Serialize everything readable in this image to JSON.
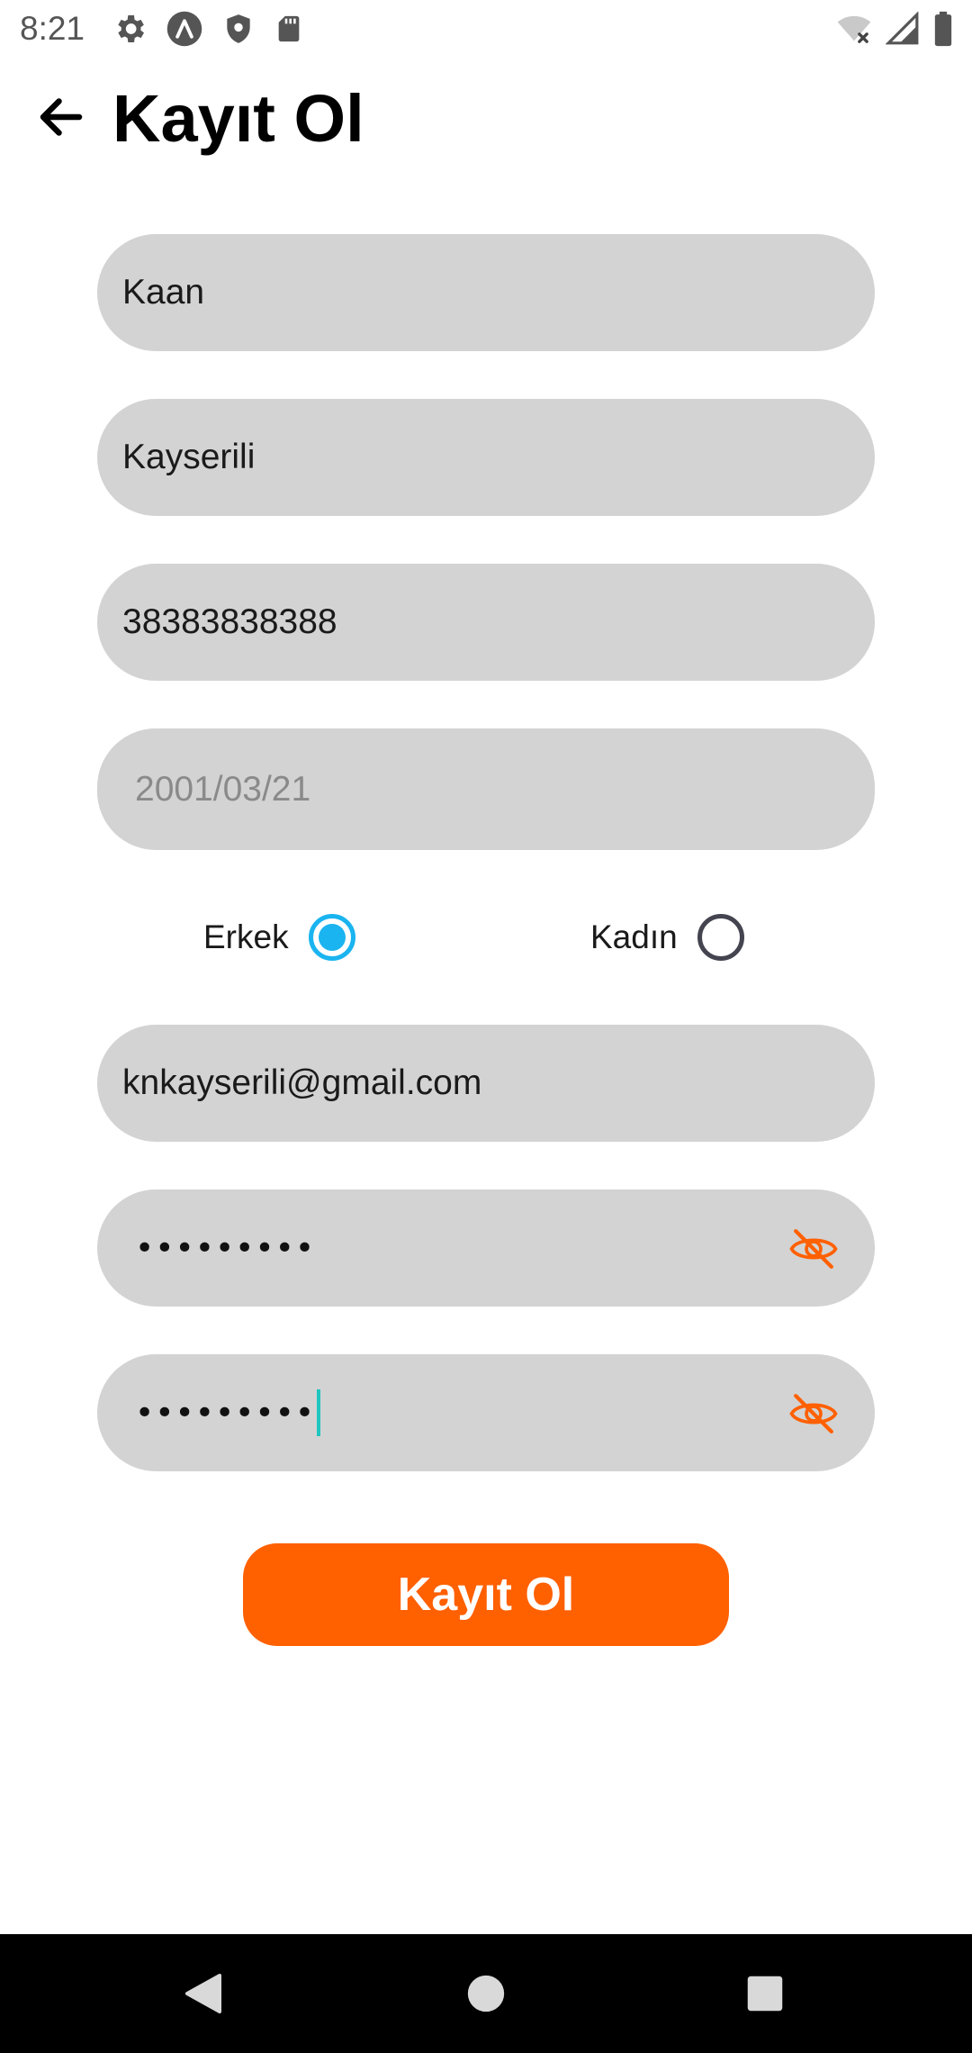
{
  "status_bar": {
    "time": "8:21",
    "left_icons": [
      "gear-icon",
      "app-logo-icon",
      "shield-icon",
      "sd-card-icon"
    ],
    "right_icons": [
      "wifi-off-icon",
      "cell-signal-icon",
      "battery-icon"
    ]
  },
  "header": {
    "title": "Kayıt Ol",
    "back_icon": "arrow-left-icon"
  },
  "form": {
    "first_name": "Kaan",
    "last_name": "Kayserili",
    "id_number": "38383838388",
    "birth_date": "2001/03/21",
    "gender": {
      "options": [
        {
          "label": "Erkek",
          "selected": true
        },
        {
          "label": "Kadın",
          "selected": false
        }
      ]
    },
    "email": "knkayserili@gmail.com",
    "password_masked": "•••••••••",
    "password_confirm_masked": "•••••••••",
    "visibility_icon": "eye-off-icon",
    "submit_label": "Kayıt Ol"
  },
  "colors": {
    "accent": "#ff6000",
    "radio_selected": "#1ab4f0",
    "field_background": "#d3d3d3",
    "caret": "#1fc6c0"
  },
  "nav_bar": {
    "buttons": [
      "back-triangle-icon",
      "home-circle-icon",
      "recents-square-icon"
    ]
  }
}
